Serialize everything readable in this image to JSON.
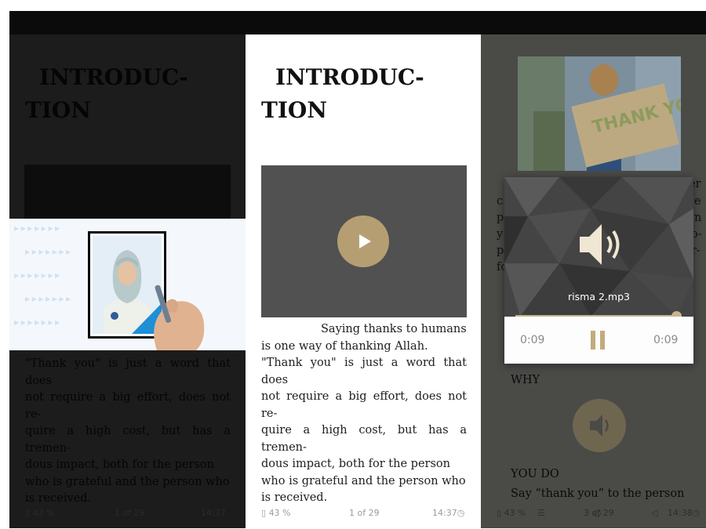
{
  "chapter_title_line1": "INTRODUC-",
  "chapter_title_line2": "TION",
  "paragraph_first_line": "Saying thanks to humans",
  "paragraph_lines": [
    "is one way of thanking Allah.",
    "\"Thank you\" is just a word that does",
    "not require a big effort, does not re-",
    "quire a high cost, but has a tremen-",
    "dous impact, both for the person",
    "who is grateful and the person who",
    "is received."
  ],
  "panel1": {
    "paragraph_lines": [
      "\"Thank you\" is just a word that does",
      "not require a big effort, does not re-",
      "quire a high cost, but has a tremen-",
      "dous impact, both for the person",
      "who is grateful and the person who",
      "is received."
    ],
    "battery": "43 %",
    "page": "1 of 29",
    "time": "14:37"
  },
  "panel2": {
    "battery": "43 %",
    "page": "1 of 29",
    "time": "14:37"
  },
  "panel3": {
    "placard_text": "THANK YOU!",
    "fragments_left": [
      "c",
      "p",
      "y",
      "p",
      "fo"
    ],
    "fragments_right": [
      "er",
      "e",
      "n",
      "o-",
      "r-"
    ],
    "section_why": "WHY",
    "section_you_do": "YOU DO",
    "you_do_text": "Say “thank you” to the person",
    "battery": "43 %",
    "page": "3 of 29",
    "time": "14:38"
  },
  "audio": {
    "filename": "risma 2.mp3",
    "elapsed": "0:09",
    "duration": "0:09",
    "progress": 1.0
  },
  "colors": {
    "accent_gold": "#b59f72",
    "video_bg": "#515151"
  },
  "icons": [
    "play-icon",
    "speaker-icon",
    "pause-icon",
    "battery-icon",
    "clock-icon",
    "menu-icon",
    "home-icon",
    "back-icon"
  ]
}
